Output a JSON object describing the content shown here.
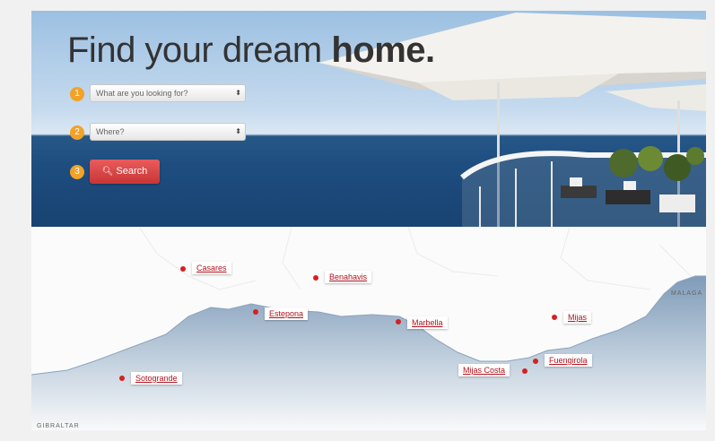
{
  "hero": {
    "title_regular": "Find your dream ",
    "title_bold": "home.",
    "step1": "1",
    "step2": "2",
    "step3": "3",
    "looking_for_placeholder": "What are you looking for?",
    "where_placeholder": "Where?",
    "search_label": "Search"
  },
  "map": {
    "locations": [
      "Casares",
      "Benahavis",
      "Estepona",
      "Marbella",
      "Mijas",
      "Sotogrande",
      "Mijas Costa",
      "Fuengirola"
    ],
    "regions": {
      "malaga": "MALAGA",
      "gibraltar": "GIBRALTAR"
    }
  },
  "colors": {
    "accent": "#d63b3b",
    "step": "#f2a227",
    "link": "#b3121b"
  }
}
